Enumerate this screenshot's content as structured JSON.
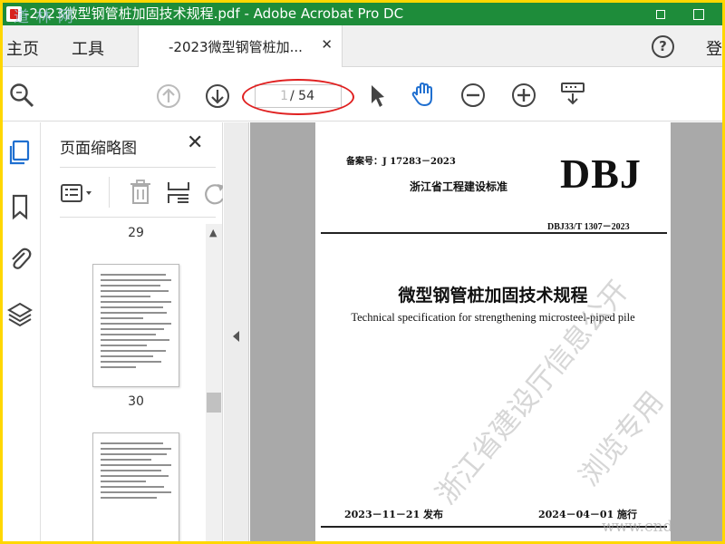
{
  "window": {
    "title": "-2023微型钢管桩加固技术规程.pdf - Adobe Acrobat Pro DC",
    "watermark_logo": "道 林 网",
    "accent": "#1e8c3a",
    "frame_color": "#ffd700"
  },
  "tabbar": {
    "home_label": "主页",
    "tools_label": "工具",
    "doc_tab_label": "-2023微型钢管桩加...",
    "close_icon": "close-icon",
    "help_label": "?",
    "signin_label": "登"
  },
  "toolbar": {
    "page_current": "1",
    "page_total": "/ 54",
    "icons": [
      "magnifier-icon",
      "page-up-icon",
      "page-down-icon",
      "select-arrow-icon",
      "hand-tool-icon",
      "zoom-out-icon",
      "zoom-in-icon",
      "fit-page-icon"
    ],
    "highlight_color": "#e02020"
  },
  "left_rail": {
    "icons": [
      "page-thumbnails-icon",
      "bookmark-icon",
      "attachment-icon",
      "layers-icon"
    ]
  },
  "thumb_panel": {
    "title": "页面缩略图",
    "close_glyph": "✕",
    "tool_icons": [
      "thumbnail-options-icon",
      "delete-page-icon",
      "insert-page-icon",
      "rotate-icon"
    ],
    "pages": [
      {
        "number": "29"
      },
      {
        "number": "30"
      }
    ]
  },
  "document": {
    "record_number": "备案号：J 17283－2023",
    "standard_label": "浙江省工程建设标准",
    "logo_text": "DBJ",
    "standard_number": "DBJ33/T 1307－2023",
    "title_cn": "微型钢管桩加固技术规程",
    "title_en": "Technical specification for strengthening microsteel-piped pile",
    "publish_date": "2023－11－21 发布",
    "effective_date": "2024－04－01 施行",
    "watermark_1": "浙江省建设厅信息公开",
    "watermark_2": "浏览专用",
    "watermark_site": "www.cnda"
  }
}
